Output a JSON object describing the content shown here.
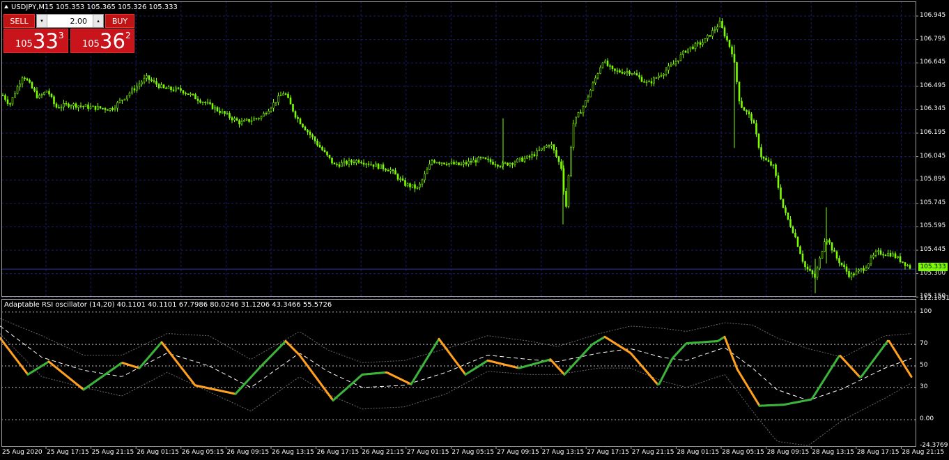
{
  "chart": {
    "title": "USDJPY,M15  105.353 105.365 105.326 105.333",
    "current_price": "105.333",
    "price_axis": [
      "106.945",
      "106.795",
      "106.645",
      "106.495",
      "106.345",
      "106.195",
      "106.045",
      "105.895",
      "105.745",
      "105.595",
      "105.445",
      "105.300",
      "105.150"
    ],
    "colors": {
      "background": "#000000",
      "grid": "#1c1c6e",
      "candles": "#7cfc00",
      "frame": "#a0a0a0",
      "current_line": "#3333aa"
    }
  },
  "trade_panel": {
    "sell_label": "SELL",
    "buy_label": "BUY",
    "lot_value": "2.00",
    "down_arrow": "▾",
    "up_arrow": "▴",
    "sell_price": {
      "prefix": "105",
      "big": "33",
      "sup": "3"
    },
    "buy_price": {
      "prefix": "105",
      "big": "36",
      "sup": "2"
    }
  },
  "indicator": {
    "title": "Adaptable RSI oscillator (14,20) 40.1101 40.1101 67.7986 80.0246 31.1206 43.3466 55.5726",
    "axis": [
      "112.1051",
      "100",
      "70",
      "50",
      "30",
      "0.00",
      "-24.3769"
    ],
    "colors": {
      "rising": "#3cb43c",
      "falling": "#ffa020",
      "signal": "#ffffff",
      "bands": "#6a6a6a",
      "levels": "#c8c8c8"
    }
  },
  "time_axis": [
    "25 Aug 2020",
    "25 Aug 17:15",
    "25 Aug 21:15",
    "26 Aug 01:15",
    "26 Aug 05:15",
    "26 Aug 09:15",
    "26 Aug 13:15",
    "26 Aug 17:15",
    "26 Aug 21:15",
    "27 Aug 01:15",
    "27 Aug 05:15",
    "27 Aug 09:15",
    "27 Aug 13:15",
    "27 Aug 17:15",
    "27 Aug 21:15",
    "28 Aug 01:15",
    "28 Aug 05:15",
    "28 Aug 09:15",
    "28 Aug 13:15",
    "28 Aug 17:15",
    "28 Aug 21:15"
  ],
  "chart_data": [
    {
      "type": "candlestick",
      "title": "USDJPY,M15",
      "xlabel": "",
      "ylabel": "",
      "ylim": [
        105.13,
        107.0
      ],
      "grid": true,
      "waypoints": [
        [
          0,
          106.46
        ],
        [
          14,
          106.38
        ],
        [
          33,
          106.57
        ],
        [
          55,
          106.42
        ],
        [
          68,
          106.47
        ],
        [
          80,
          106.36
        ],
        [
          100,
          106.38
        ],
        [
          130,
          106.36
        ],
        [
          160,
          106.35
        ],
        [
          210,
          106.55
        ],
        [
          235,
          106.48
        ],
        [
          260,
          106.47
        ],
        [
          290,
          106.4
        ],
        [
          345,
          106.26
        ],
        [
          375,
          106.3
        ],
        [
          408,
          106.46
        ],
        [
          425,
          106.3
        ],
        [
          460,
          106.1
        ],
        [
          480,
          105.99
        ],
        [
          515,
          106.02
        ],
        [
          560,
          105.96
        ],
        [
          580,
          105.87
        ],
        [
          600,
          105.84
        ],
        [
          620,
          106.02
        ],
        [
          660,
          105.99
        ],
        [
          690,
          106.03
        ],
        [
          720,
          105.99
        ],
        [
          760,
          106.04
        ],
        [
          790,
          106.13
        ],
        [
          806,
          105.97
        ],
        [
          812,
          105.7
        ],
        [
          822,
          106.25
        ],
        [
          840,
          106.39
        ],
        [
          865,
          106.66
        ],
        [
          880,
          106.59
        ],
        [
          905,
          106.59
        ],
        [
          930,
          106.51
        ],
        [
          965,
          106.63
        ],
        [
          985,
          106.73
        ],
        [
          1010,
          106.78
        ],
        [
          1033,
          106.9
        ],
        [
          1052,
          106.7
        ],
        [
          1062,
          106.38
        ],
        [
          1080,
          106.28
        ],
        [
          1093,
          106.04
        ],
        [
          1110,
          105.98
        ],
        [
          1125,
          105.7
        ],
        [
          1140,
          105.55
        ],
        [
          1155,
          105.34
        ],
        [
          1170,
          105.27
        ],
        [
          1185,
          105.54
        ],
        [
          1200,
          105.4
        ],
        [
          1220,
          105.28
        ],
        [
          1240,
          105.33
        ],
        [
          1258,
          105.43
        ],
        [
          1280,
          105.42
        ],
        [
          1308,
          105.33
        ]
      ]
    },
    {
      "type": "line",
      "title": "Adaptable RSI oscillator (14,20)",
      "ylim": [
        -24.3769,
        112.1051
      ],
      "levels": [
        100,
        70,
        50,
        30,
        0
      ],
      "series": [
        {
          "name": "Adaptable RSI",
          "waypoints": [
            [
              0,
              76
            ],
            [
              40,
              42
            ],
            [
              70,
              54
            ],
            [
              120,
              28
            ],
            [
              175,
              53
            ],
            [
              200,
              48
            ],
            [
              232,
              72
            ],
            [
              280,
              32
            ],
            [
              338,
              24
            ],
            [
              375,
              50
            ],
            [
              410,
              73
            ],
            [
              430,
              60
            ],
            [
              478,
              18
            ],
            [
              520,
              42
            ],
            [
              555,
              44
            ],
            [
              590,
              33
            ],
            [
              630,
              75
            ],
            [
              668,
              42
            ],
            [
              700,
              55
            ],
            [
              745,
              48
            ],
            [
              790,
              56
            ],
            [
              810,
              42
            ],
            [
              850,
              70
            ],
            [
              868,
              77
            ],
            [
              905,
              62
            ],
            [
              945,
              32
            ],
            [
              965,
              57
            ],
            [
              985,
              71
            ],
            [
              1030,
              73
            ],
            [
              1040,
              77
            ],
            [
              1058,
              47
            ],
            [
              1090,
              13
            ],
            [
              1125,
              14
            ],
            [
              1165,
              19
            ],
            [
              1205,
              60
            ],
            [
              1235,
              39
            ],
            [
              1275,
              74
            ],
            [
              1308,
              40
            ]
          ]
        },
        {
          "name": "Signal",
          "waypoints": [
            [
              0,
              87
            ],
            [
              60,
              58
            ],
            [
              120,
              46
            ],
            [
              175,
              40
            ],
            [
              240,
              62
            ],
            [
              300,
              50
            ],
            [
              360,
              30
            ],
            [
              430,
              62
            ],
            [
              470,
              45
            ],
            [
              520,
              30
            ],
            [
              580,
              32
            ],
            [
              640,
              44
            ],
            [
              700,
              60
            ],
            [
              760,
              56
            ],
            [
              800,
              54
            ],
            [
              860,
              62
            ],
            [
              905,
              66
            ],
            [
              950,
              58
            ],
            [
              985,
              55
            ],
            [
              1040,
              67
            ],
            [
              1080,
              48
            ],
            [
              1115,
              28
            ],
            [
              1160,
              18
            ],
            [
              1210,
              29
            ],
            [
              1270,
              48
            ],
            [
              1308,
              57
            ]
          ]
        },
        {
          "name": "Upper band",
          "waypoints": [
            [
              0,
              94
            ],
            [
              60,
              78
            ],
            [
              120,
              60
            ],
            [
              175,
              60
            ],
            [
              240,
              80
            ],
            [
              300,
              78
            ],
            [
              360,
              56
            ],
            [
              430,
              82
            ],
            [
              470,
              65
            ],
            [
              520,
              53
            ],
            [
              580,
              55
            ],
            [
              640,
              66
            ],
            [
              700,
              78
            ],
            [
              760,
              73
            ],
            [
              800,
              68
            ],
            [
              860,
              80
            ],
            [
              905,
              87
            ],
            [
              950,
              85
            ],
            [
              985,
              82
            ],
            [
              1040,
              90
            ],
            [
              1080,
              88
            ],
            [
              1115,
              76
            ],
            [
              1160,
              66
            ],
            [
              1210,
              58
            ],
            [
              1270,
              78
            ],
            [
              1308,
              80
            ]
          ]
        },
        {
          "name": "Lower band",
          "waypoints": [
            [
              0,
              80
            ],
            [
              60,
              40
            ],
            [
              120,
              30
            ],
            [
              175,
              22
            ],
            [
              240,
              44
            ],
            [
              300,
              26
            ],
            [
              360,
              8
            ],
            [
              430,
              40
            ],
            [
              470,
              24
            ],
            [
              520,
              10
            ],
            [
              580,
              12
            ],
            [
              640,
              24
            ],
            [
              700,
              45
            ],
            [
              760,
              42
            ],
            [
              800,
              42
            ],
            [
              860,
              48
            ],
            [
              905,
              48
            ],
            [
              950,
              36
            ],
            [
              985,
              30
            ],
            [
              1040,
              42
            ],
            [
              1080,
              8
            ],
            [
              1115,
              -20
            ],
            [
              1160,
              -24
            ],
            [
              1210,
              0
            ],
            [
              1270,
              20
            ],
            [
              1308,
              34
            ]
          ]
        }
      ]
    }
  ]
}
